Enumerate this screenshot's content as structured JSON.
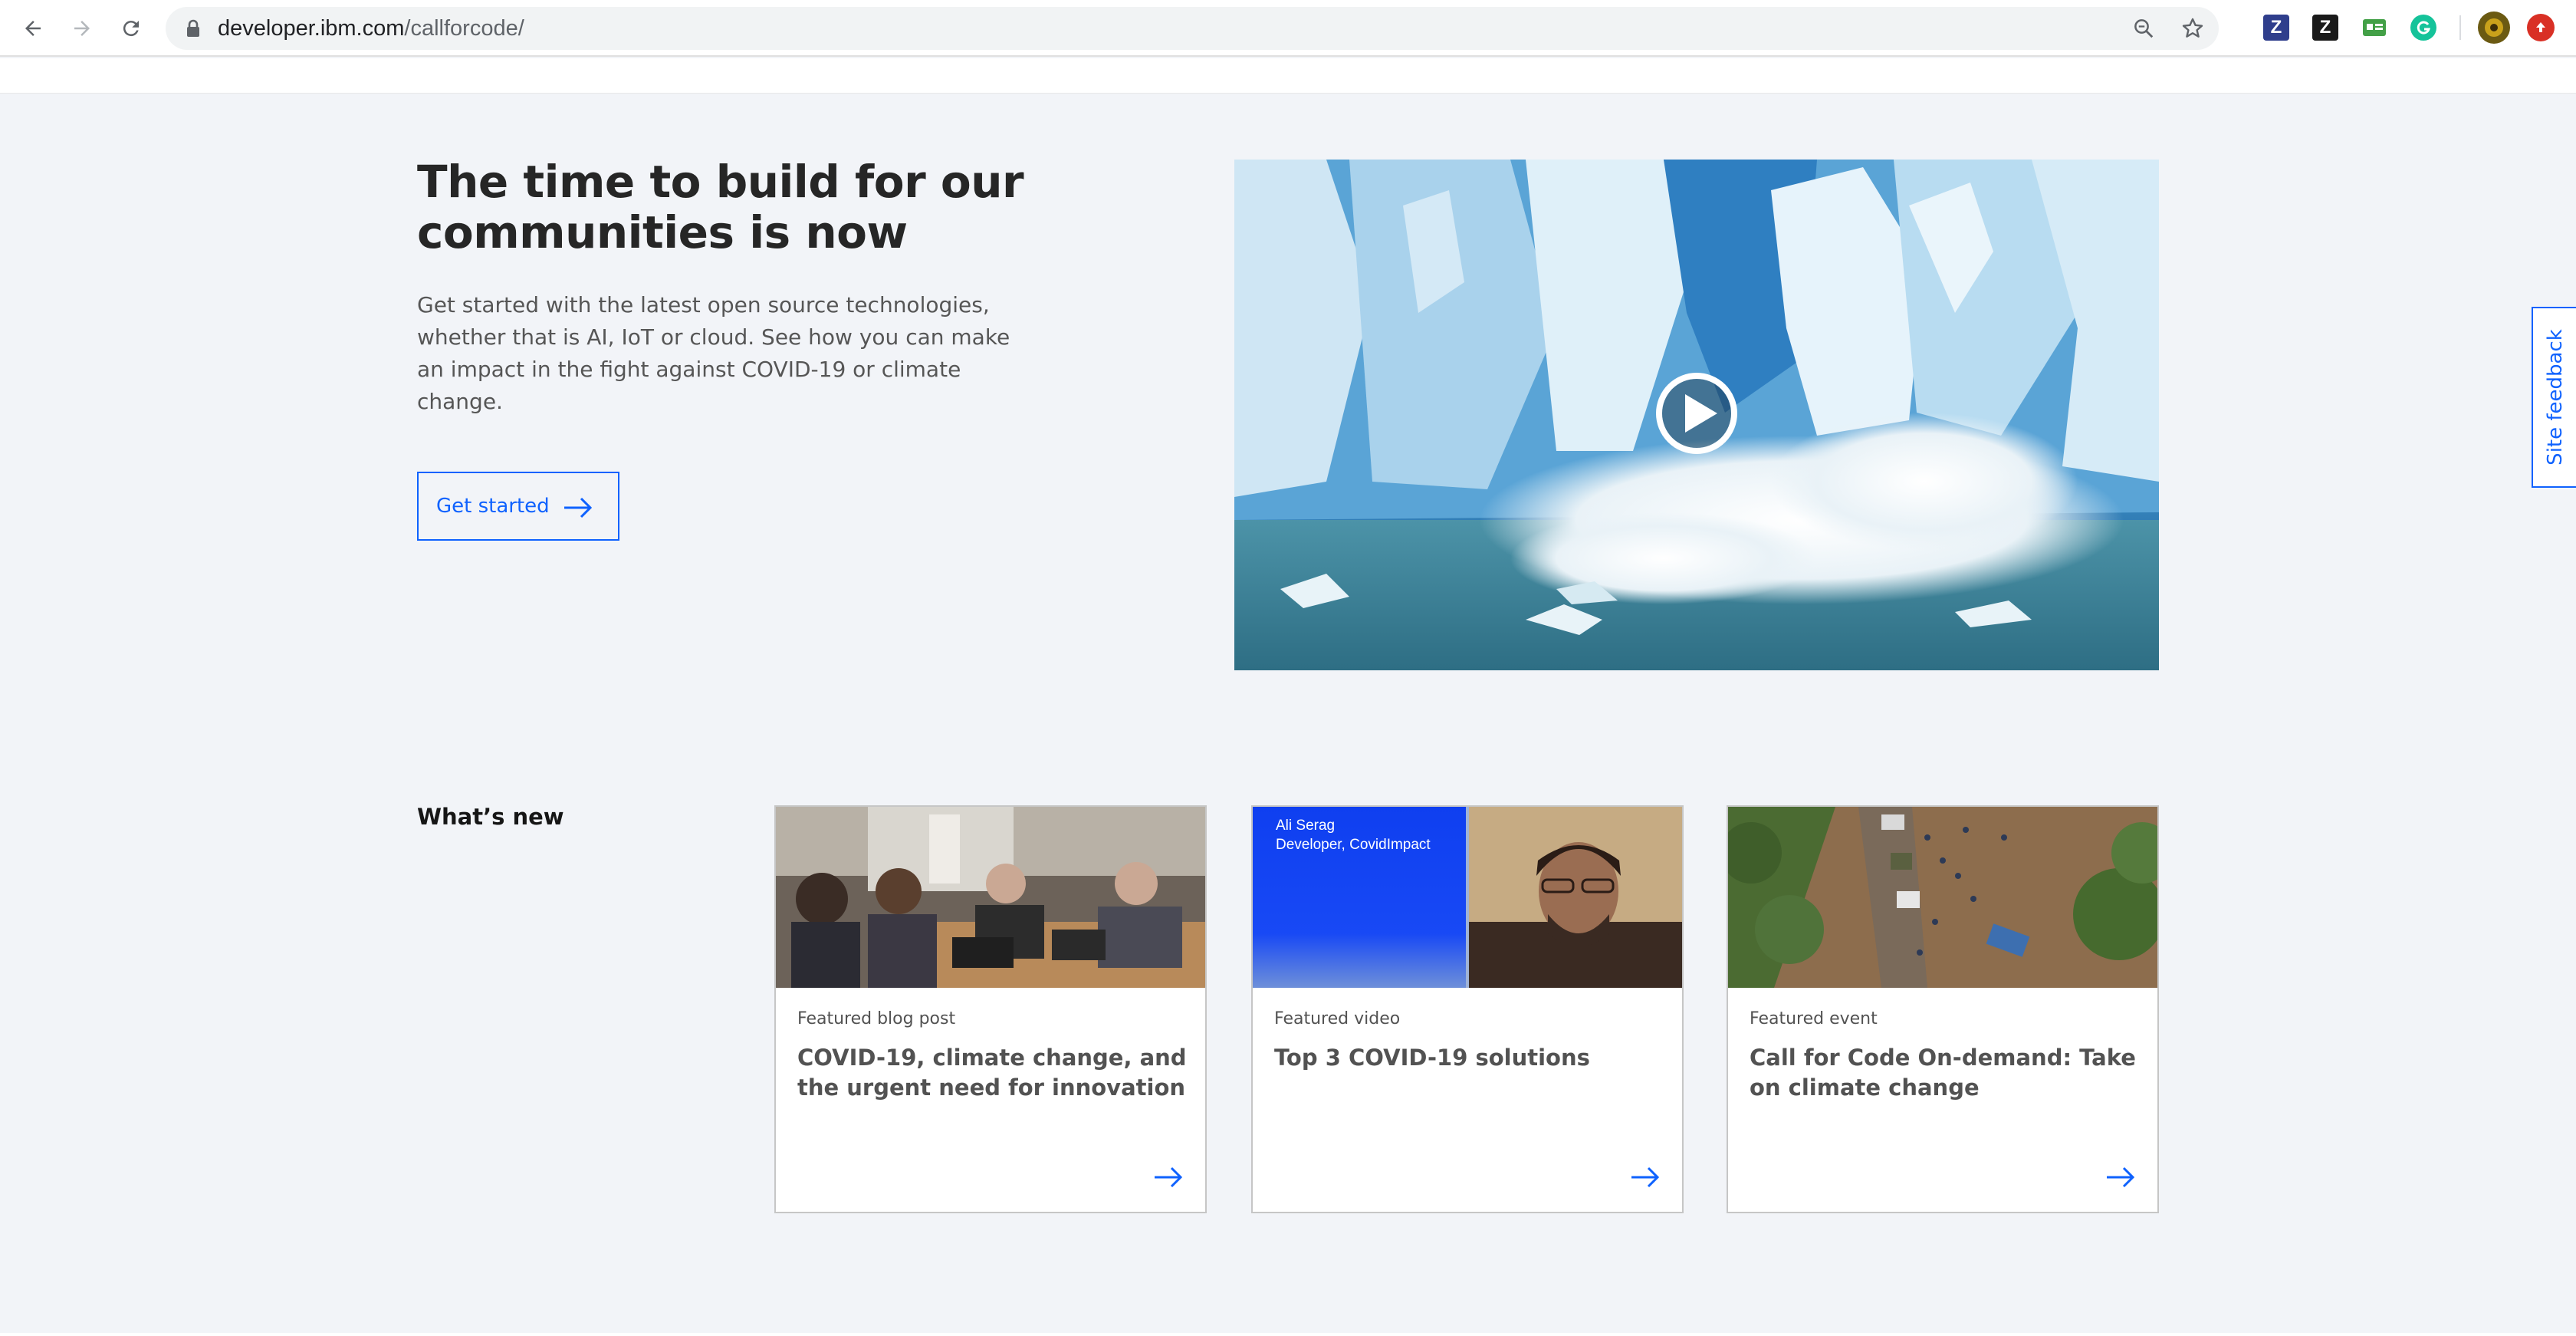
{
  "browser": {
    "url_domain": "developer.ibm.com",
    "url_path": "/callforcode/",
    "extensions": [
      {
        "name": "zotero-icon",
        "letter": "Z",
        "color": "#2f3e8c"
      },
      {
        "name": "zotero-connector-icon",
        "letter": "Z",
        "color": "#1a1a1a"
      },
      {
        "name": "meet-icon",
        "letter": "",
        "color": "#43a047"
      },
      {
        "name": "grammarly-icon",
        "letter": "",
        "color": "#15c39a"
      }
    ]
  },
  "hero": {
    "title": "The time to build for our communities is now",
    "description": "Get started with the latest open source technologies, whether that is AI, IoT or cloud. See how you can make an impact in the fight against COVID-19 or climate change.",
    "cta_label": "Get started",
    "video_icon": "play-icon"
  },
  "feedback": {
    "label": "Site feedback"
  },
  "whats_new": {
    "title": "What’s new",
    "cards": [
      {
        "type": "Featured blog post",
        "title": "COVID-19, climate change, and the urgent need for innovation"
      },
      {
        "type": "Featured video",
        "title": "Top 3 COVID-19 solutions",
        "video_caption_name": "Ali Serag",
        "video_caption_role": "Developer, CovidImpact"
      },
      {
        "type": "Featured event",
        "title": "Call for Code On-demand: Take on climate change"
      }
    ]
  },
  "colors": {
    "accent": "#0f62fe",
    "background": "#f2f4f8",
    "text": "#161616"
  }
}
